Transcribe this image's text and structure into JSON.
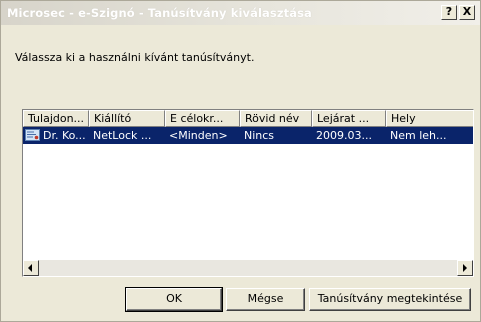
{
  "window": {
    "title": "Microsec - e-Szignó - Tanúsítvány kiválasztása",
    "help_label": "?",
    "close_label": "X"
  },
  "instruction": "Válassza ki a használni kívánt tanúsítványt.",
  "list": {
    "columns": [
      "Tulajdon...",
      "Kiállító",
      "E célokr...",
      "Rövid név",
      "Lejárat ...",
      "Hely"
    ],
    "rows": [
      {
        "icon": "certificate-icon",
        "selected": true,
        "cells": [
          "Dr. Ko...",
          "NetLock ...",
          "<Minden>",
          "Nincs",
          "2009.03...",
          "Nem leh..."
        ]
      }
    ]
  },
  "buttons": {
    "ok": "OK",
    "cancel": "Mégse",
    "view": "Tanúsítvány megtekintése"
  },
  "colors": {
    "selection": "#0a246a",
    "dialog_bg": "#ece9d8"
  }
}
